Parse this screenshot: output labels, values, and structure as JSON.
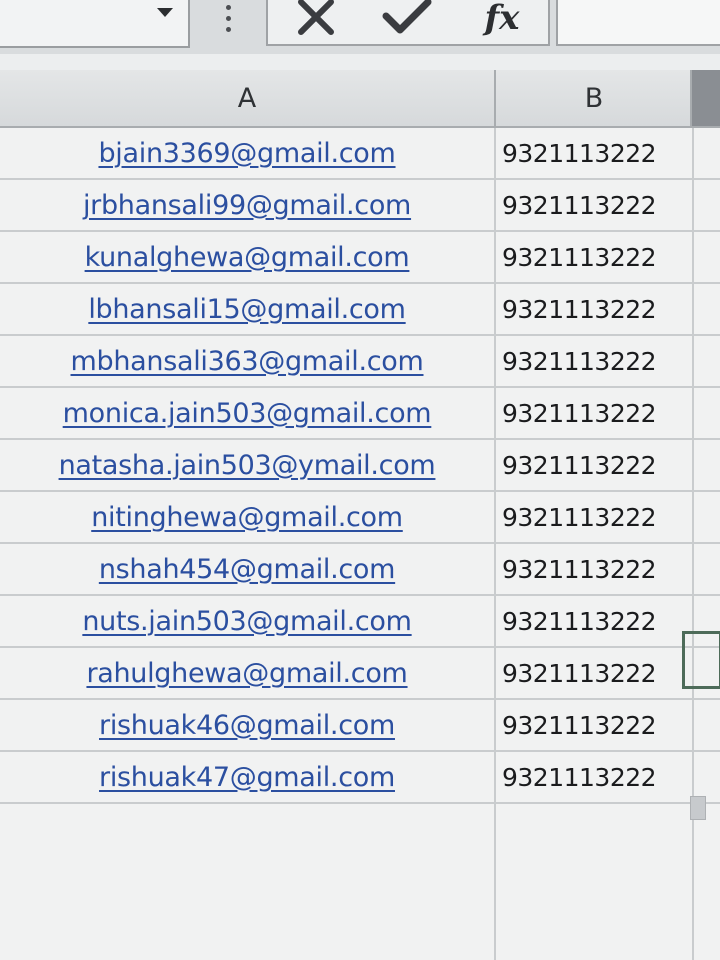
{
  "formula_bar": {
    "cancel_icon": "x-icon",
    "enter_icon": "checkmark-icon",
    "function_icon": "fx-icon",
    "function_label": "fx",
    "formula_value": ""
  },
  "columns": [
    {
      "label": "A"
    },
    {
      "label": "B"
    }
  ],
  "rows": [
    {
      "email": "bjain3369@gmail.com",
      "phone": "9321113222"
    },
    {
      "email": "jrbhansali99@gmail.com",
      "phone": "9321113222"
    },
    {
      "email": "kunalghewa@gmail.com",
      "phone": "9321113222"
    },
    {
      "email": "lbhansali15@gmail.com",
      "phone": "9321113222"
    },
    {
      "email": "mbhansali363@gmail.com",
      "phone": "9321113222"
    },
    {
      "email": "monica.jain503@gmail.com",
      "phone": "9321113222"
    },
    {
      "email": "natasha.jain503@ymail.com",
      "phone": "9321113222"
    },
    {
      "email": "nitinghewa@gmail.com",
      "phone": "9321113222"
    },
    {
      "email": "nshah454@gmail.com",
      "phone": "9321113222"
    },
    {
      "email": "nuts.jain503@gmail.com",
      "phone": "9321113222"
    },
    {
      "email": "rahulghewa@gmail.com",
      "phone": "9321113222"
    },
    {
      "email": "rishuak46@gmail.com",
      "phone": "9321113222"
    },
    {
      "email": "rishuak47@gmail.com",
      "phone": "9321113222"
    }
  ],
  "colors": {
    "hyperlink": "#2b4fa0",
    "cell_text": "#1a1b1d",
    "grid_line": "#c9ccce",
    "selection_border": "#4d6b59"
  }
}
